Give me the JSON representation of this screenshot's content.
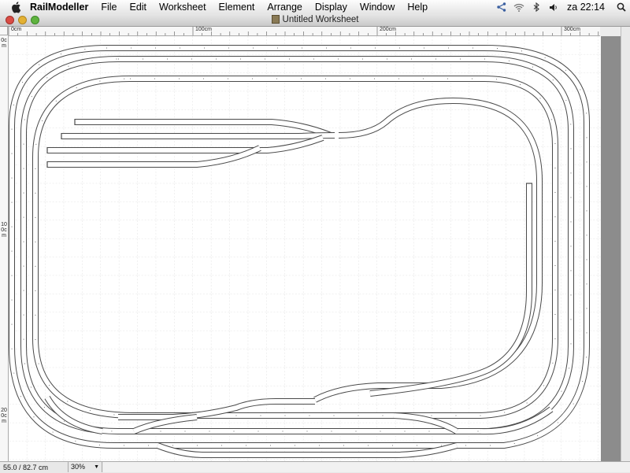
{
  "menubar": {
    "app_name": "RailModeller",
    "items": [
      "File",
      "Edit",
      "Worksheet",
      "Element",
      "Arrange",
      "Display",
      "Window",
      "Help"
    ],
    "clock": "za 22:14",
    "status_icons": [
      "network-icon",
      "wifi-icon",
      "bluetooth-icon",
      "volume-icon",
      "spotlight-icon"
    ]
  },
  "window": {
    "title": "Untitled Worksheet"
  },
  "rulers": {
    "horizontal": [
      "0cm",
      "100cm",
      "200cm",
      "300cm"
    ],
    "vertical": [
      "0cm",
      "100cm",
      "200cm"
    ]
  },
  "status": {
    "coordinates": "55.0 /  82.7 cm",
    "zoom": "30%"
  },
  "colors": {
    "track": "#4a4a4a",
    "grid": "#d8d8d8",
    "canvas": "#ffffff",
    "sidebar": "#8c8c8c"
  }
}
